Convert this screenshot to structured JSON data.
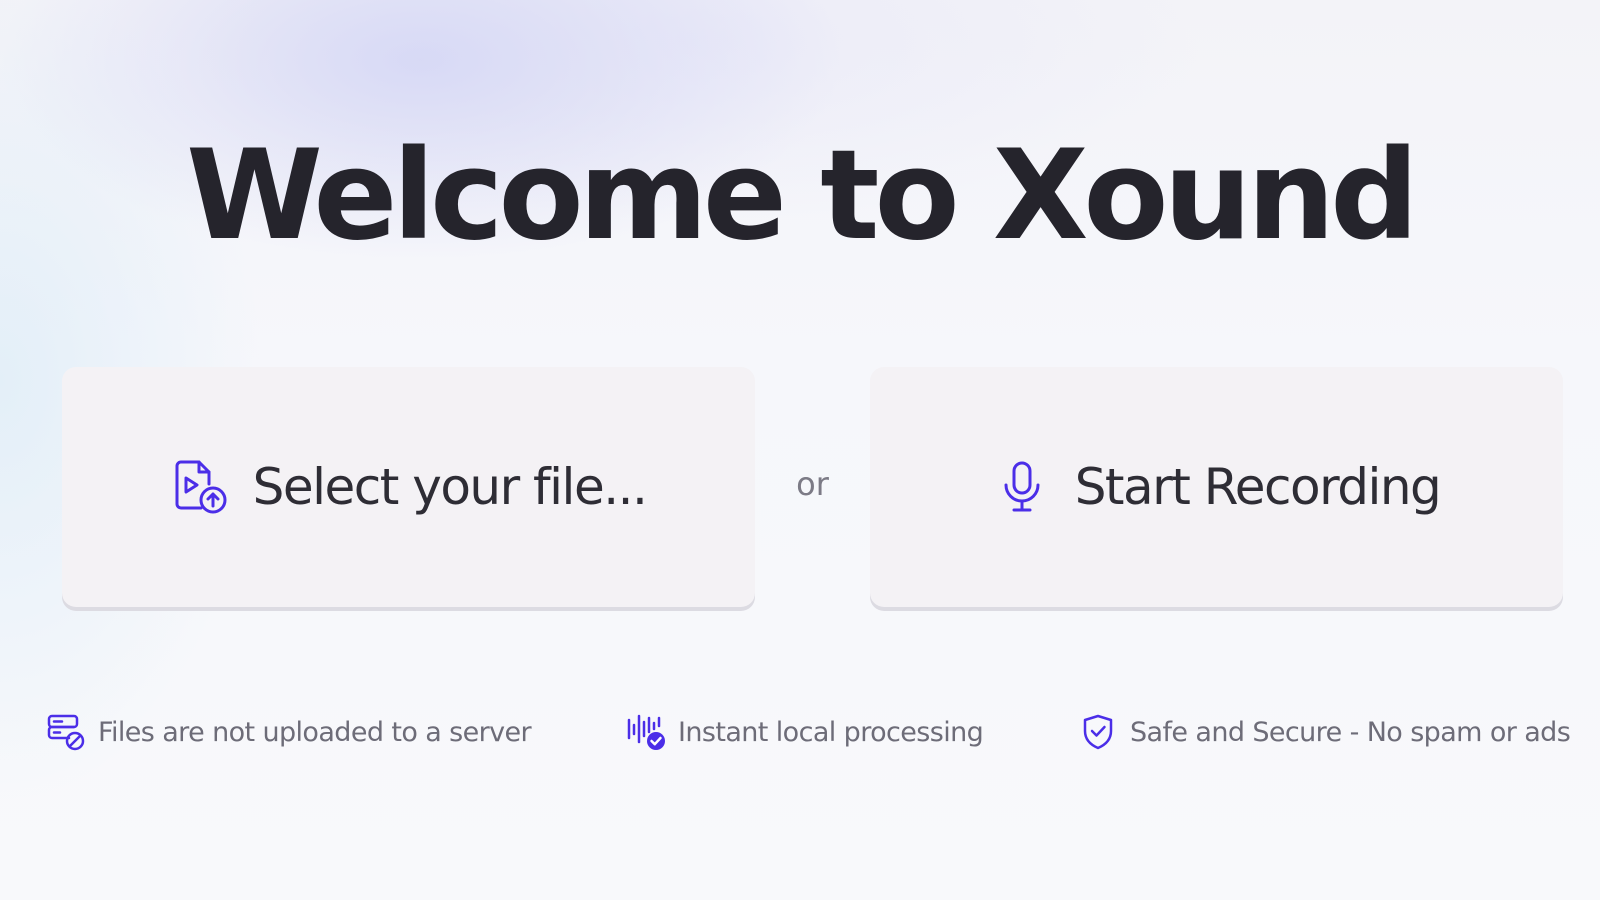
{
  "app": {
    "title": "Welcome to Xound"
  },
  "actions": {
    "select_file": {
      "label": "Select your file...",
      "icon": "file-video-upload-icon"
    },
    "separator": "or",
    "start_recording": {
      "label": "Start Recording",
      "icon": "microphone-icon"
    }
  },
  "features": [
    {
      "icon": "server-off-icon",
      "text": "Files are not uploaded to a server"
    },
    {
      "icon": "waveform-check-icon",
      "text": "Instant local processing"
    },
    {
      "icon": "shield-check-icon",
      "text": "Safe and Secure - No spam or ads"
    }
  ],
  "colors": {
    "accent": "#4b2ee8",
    "title": "#25242c",
    "card_bg": "#f4f2f5",
    "muted_text": "#6d6c78"
  }
}
